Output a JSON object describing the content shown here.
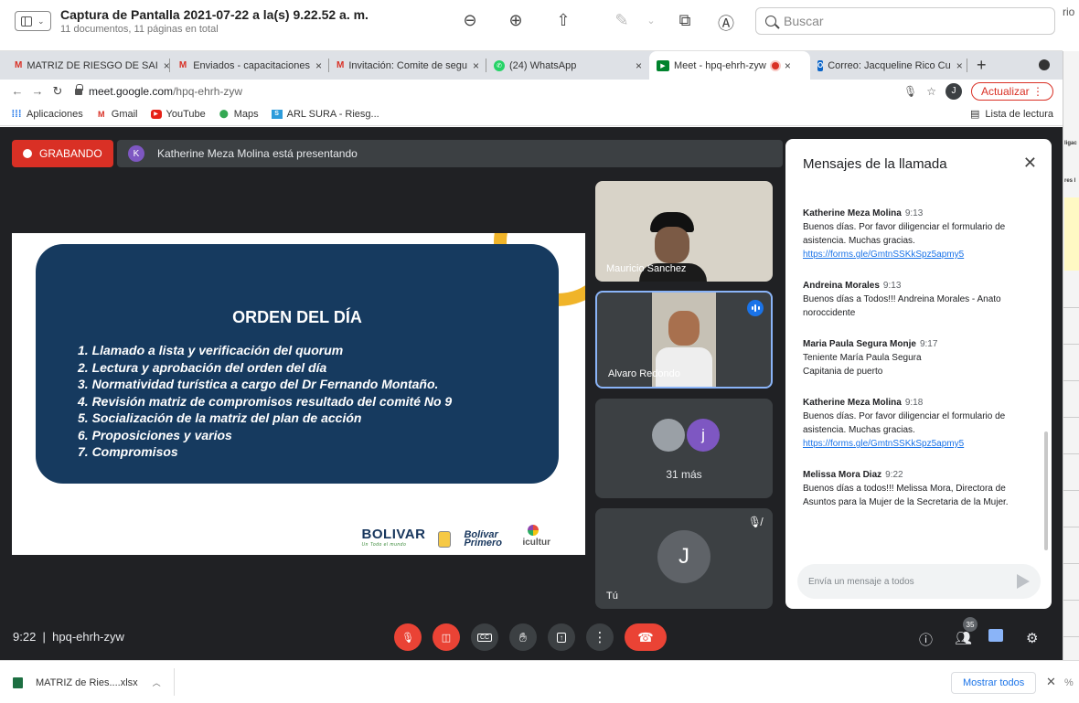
{
  "preview": {
    "title": "Captura de Pantalla 2021-07-22 a la(s) 9.22.52 a. m.",
    "subtitle": "11 documentos, 11 páginas en total",
    "search_placeholder": "Buscar",
    "right_cut_text": "rio"
  },
  "browser": {
    "tabs": [
      {
        "label": "MATRIZ DE RIESGO DE SAI",
        "favicon": "gmail-icon"
      },
      {
        "label": "Enviados - capacitaciones",
        "favicon": "gmail-icon"
      },
      {
        "label": "Invitación: Comite de segu",
        "favicon": "gmail-icon"
      },
      {
        "label": "(24) WhatsApp",
        "favicon": "whatsapp-icon"
      },
      {
        "label": "Meet - hpq-ehrh-zyw",
        "favicon": "meet-icon",
        "active": true
      },
      {
        "label": "Correo: Jacqueline Rico Cu",
        "favicon": "outlook-icon"
      }
    ],
    "url_host": "meet.google.com",
    "url_path": "/hpq-ehrh-zyw",
    "profile_initial": "J",
    "update_label": "Actualizar",
    "bookmarks": [
      {
        "label": "Aplicaciones",
        "icon": "apps-icon"
      },
      {
        "label": "Gmail",
        "icon": "gmail-icon"
      },
      {
        "label": "YouTube",
        "icon": "youtube-icon"
      },
      {
        "label": "Maps",
        "icon": "maps-icon"
      },
      {
        "label": "ARL SURA - Riesg...",
        "icon": "arl-icon"
      }
    ],
    "reading_list": "Lista de lectura"
  },
  "meet": {
    "recording_label": "GRABANDO",
    "presenter_initial": "K",
    "presenting_text": "Katherine Meza Molina está presentando",
    "slide": {
      "title": "ORDEN DEL DÍA",
      "items": [
        "1. Llamado a lista y verificación del quorum",
        "2. Lectura y aprobación del orden del día",
        "3. Normatividad turística a cargo del  Dr Fernando Montaño.",
        "4. Revisión matriz de compromisos resultado del comité No 9",
        "5. Socialización de la matriz del plan de acción",
        "6. Proposiciones y varios",
        "7. Compromisos"
      ],
      "logo_bolivar": "BOLIVAR",
      "logo_bolivar_sub": "Un Todo el mundo",
      "logo_primero": "Bolívar Primero",
      "logo_icultur": "icultur"
    },
    "participants": [
      {
        "name": "Mauricio Sanchez"
      },
      {
        "name": "Alvaro Redondo"
      },
      {
        "more_initial": "j",
        "more_label": "31 más"
      },
      {
        "name": "Tú",
        "initial": "J"
      }
    ],
    "chat": {
      "title": "Mensajes de la llamada",
      "messages": [
        {
          "author": "Katherine Meza Molina",
          "time": "9:13",
          "text": "Buenos días. Por favor diligenciar el formulario de asistencia. Muchas gracias.",
          "link": "https://forms.gle/GmtnSSKkSpz5apmy5"
        },
        {
          "author": "Andreina Morales",
          "time": "9:13",
          "text": "Buenos días a Todos!!! Andreina Morales - Anato noroccidente"
        },
        {
          "author": "Maria Paula Segura Monje",
          "time": "9:17",
          "text": "Teniente María Paula Segura Capitania de puerto"
        },
        {
          "author": "Katherine Meza Molina",
          "time": "9:18",
          "text": "Buenos días. Por favor diligenciar el formulario de asistencia. Muchas gracias.",
          "link": "https://forms.gle/GmtnSSKkSpz5apmy5"
        },
        {
          "author": "Melissa Mora Diaz",
          "time": "9:22",
          "text": "Buenos días a todos!!! Melissa Mora, Directora de Asuntos para la Mujer de la Secretaria de la Mujer."
        }
      ],
      "input_placeholder": "Envía un mensaje a todos"
    },
    "meeting_time": "9:22",
    "meeting_code": "hpq-ehrh-zyw",
    "people_count": "35"
  },
  "downloads": {
    "file": "MATRIZ de Ries....xlsx",
    "show_all": "Mostrar todos"
  },
  "right_strip": {
    "t1": "ligac",
    "t2": "res l",
    "t3": "%"
  }
}
